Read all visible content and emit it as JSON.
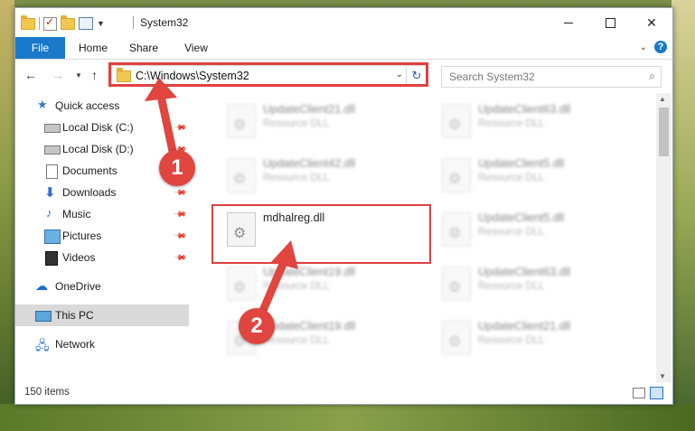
{
  "window": {
    "title": "System32",
    "minimize_glyph": "",
    "close_glyph": "✕"
  },
  "ribbon": {
    "tabs": [
      "File",
      "Home",
      "Share",
      "View"
    ]
  },
  "address": {
    "path": "C:\\Windows\\System32",
    "refresh_glyph": "↻",
    "dropdown_glyph": "⌄"
  },
  "search": {
    "placeholder": "Search System32"
  },
  "sidebar": {
    "items": [
      {
        "label": "Quick access",
        "icon": "star-icon",
        "pinned": false
      },
      {
        "label": "Local Disk (C:)",
        "icon": "drive-icon",
        "pinned": true
      },
      {
        "label": "Local Disk (D:)",
        "icon": "drive-icon",
        "pinned": true
      },
      {
        "label": "Documents",
        "icon": "document-icon",
        "pinned": true
      },
      {
        "label": "Downloads",
        "icon": "download-icon",
        "pinned": true
      },
      {
        "label": "Music",
        "icon": "music-icon",
        "pinned": true
      },
      {
        "label": "Pictures",
        "icon": "pictures-icon",
        "pinned": true
      },
      {
        "label": "Videos",
        "icon": "videos-icon",
        "pinned": true
      },
      {
        "label": "OneDrive",
        "icon": "cloud-icon",
        "pinned": false
      },
      {
        "label": "This PC",
        "icon": "computer-icon",
        "pinned": false
      },
      {
        "label": "Network",
        "icon": "network-icon",
        "pinned": false
      }
    ]
  },
  "files": [
    {
      "name": "UpdateClient21.dll",
      "type": "Resource DLL",
      "blurred": true
    },
    {
      "name": "UpdateClient63.dll",
      "type": "Resource DLL",
      "blurred": true
    },
    {
      "name": "UpdateClient42.dll",
      "type": "Resource DLL",
      "blurred": true
    },
    {
      "name": "UpdateClient5.dll",
      "type": "Resource DLL",
      "blurred": true
    },
    {
      "name": "mdhalreg.dll",
      "type": "",
      "blurred": false
    },
    {
      "name": "UpdateClient5.dll",
      "type": "Resource DLL",
      "blurred": true
    },
    {
      "name": "UpdateClient19.dll",
      "type": "Resource DLL",
      "blurred": true
    },
    {
      "name": "UpdateClient63.dll",
      "type": "Resource DLL",
      "blurred": true
    },
    {
      "name": "UpdateClient19.dll",
      "type": "Resource DLL",
      "blurred": true
    },
    {
      "name": "UpdateClient21.dll",
      "type": "Resource DLL",
      "blurred": true
    }
  ],
  "status": {
    "item_count": "150 items"
  },
  "annotations": {
    "badge_1": "1",
    "badge_2": "2",
    "color": "#e0453f"
  }
}
